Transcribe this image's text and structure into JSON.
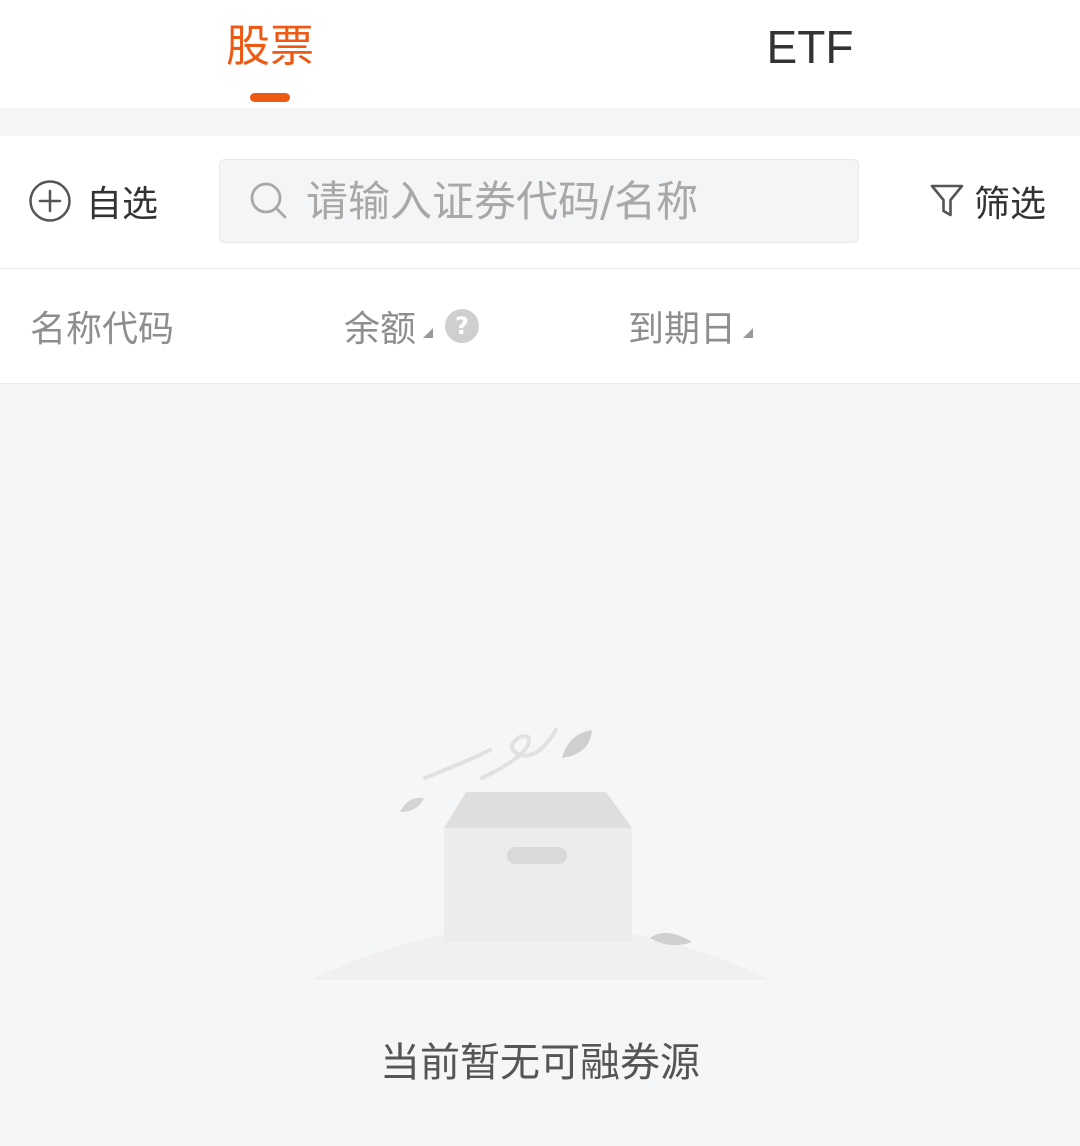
{
  "tabs": {
    "stocks": "股票",
    "etf": "ETF",
    "active": "stocks"
  },
  "toolbar": {
    "watchlist_label": "自选",
    "search_placeholder": "请输入证券代码/名称",
    "search_value": "",
    "filter_label": "筛选"
  },
  "table_header": {
    "name_code": "名称代码",
    "balance": "余额",
    "expiry": "到期日"
  },
  "empty_state": {
    "message": "当前暂无可融券源"
  },
  "colors": {
    "accent": "#ee5a14",
    "background": "#f5f6f8",
    "text_primary": "#333333",
    "text_secondary": "#8e8e8e"
  },
  "icons": [
    "add-circle-icon",
    "search-icon",
    "filter-icon",
    "sort-triangle-icon",
    "help-icon",
    "empty-box-icon"
  ]
}
